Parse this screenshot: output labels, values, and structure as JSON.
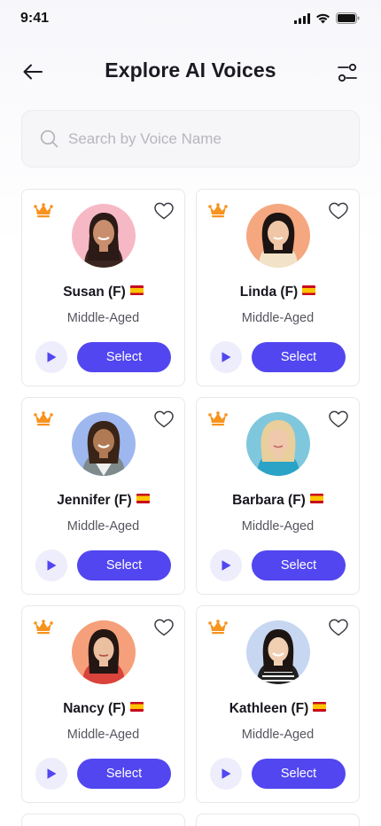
{
  "status_bar": {
    "time": "9:41"
  },
  "header": {
    "title": "Explore AI Voices"
  },
  "search": {
    "placeholder": "Search by Voice Name"
  },
  "colors": {
    "accent": "#5246f0",
    "crown": "#f7931e",
    "play_bg": "#eeedfb"
  },
  "icons": {
    "back": "arrow-left-icon",
    "filter": "filter-sliders-icon",
    "search": "search-icon",
    "premium": "crown-icon",
    "favorite": "heart-outline-icon",
    "play": "play-icon",
    "flag": "spain-flag-icon"
  },
  "voices": [
    {
      "name": "Susan (F)",
      "age": "Middle-Aged",
      "select_label": "Select"
    },
    {
      "name": "Linda (F)",
      "age": "Middle-Aged",
      "select_label": "Select"
    },
    {
      "name": "Jennifer (F)",
      "age": "Middle-Aged",
      "select_label": "Select"
    },
    {
      "name": "Barbara (F)",
      "age": "Middle-Aged",
      "select_label": "Select"
    },
    {
      "name": "Nancy (F)",
      "age": "Middle-Aged",
      "select_label": "Select"
    },
    {
      "name": "Kathleen (F)",
      "age": "Middle-Aged",
      "select_label": "Select"
    }
  ]
}
